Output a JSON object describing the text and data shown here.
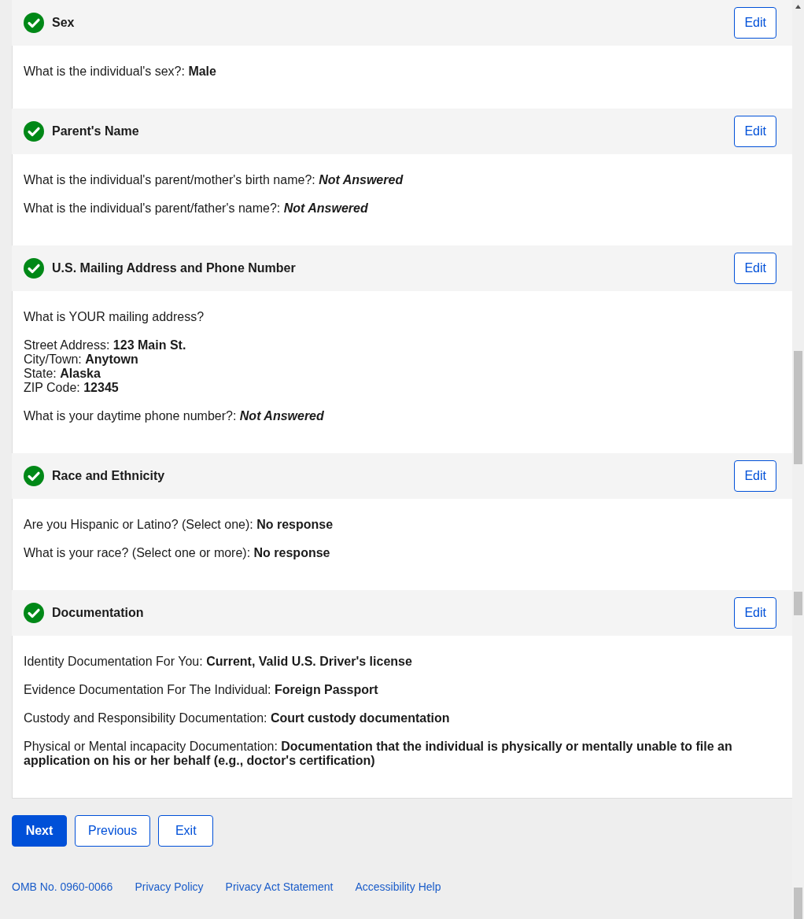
{
  "sections": [
    {
      "title": "Sex",
      "completed": true,
      "edit_button": "Edit",
      "items": [
        {
          "kind": "answer",
          "question": "What is the individual's sex?:",
          "answer": "Male",
          "answered": true
        }
      ]
    },
    {
      "title": "Parent's Name",
      "completed": true,
      "edit_button": "Edit",
      "items": [
        {
          "kind": "answer",
          "question": "What is the individual's parent/mother's birth name?:",
          "answer": "Not Answered",
          "answered": false
        },
        {
          "kind": "answer",
          "question": "What is the individual's parent/father's name?:",
          "answer": "Not Answered",
          "answered": false
        }
      ]
    },
    {
      "title": "U.S. Mailing Address and Phone Number",
      "completed": true,
      "edit_button": "Edit",
      "items": [
        {
          "kind": "heading",
          "text": "What is YOUR mailing address?"
        },
        {
          "kind": "address",
          "lines": [
            {
              "label": "Street Address:",
              "value": "123 Main St."
            },
            {
              "label": "City/Town:",
              "value": "Anytown"
            },
            {
              "label": "State:",
              "value": "Alaska"
            },
            {
              "label": "ZIP Code:",
              "value": "12345"
            }
          ]
        },
        {
          "kind": "answer",
          "question": "What is your daytime phone number?:",
          "answer": "Not Answered",
          "answered": false
        }
      ]
    },
    {
      "title": "Race and Ethnicity",
      "completed": true,
      "edit_button": "Edit",
      "items": [
        {
          "kind": "answer",
          "question": "Are you Hispanic or Latino? (Select one):",
          "answer": "No response",
          "answered": true
        },
        {
          "kind": "answer",
          "question": "What is your race? (Select one or more):",
          "answer": "No response",
          "answered": true
        }
      ]
    },
    {
      "title": "Documentation",
      "completed": true,
      "edit_button": "Edit",
      "items": [
        {
          "kind": "answer",
          "question": "Identity Documentation For You:",
          "answer": "Current, Valid U.S. Driver's license",
          "answered": true
        },
        {
          "kind": "answer",
          "question": "Evidence Documentation For The Individual:",
          "answer": "Foreign Passport",
          "answered": true
        },
        {
          "kind": "answer",
          "question": "Custody and Responsibility Documentation:",
          "answer": "Court custody documentation",
          "answered": true
        },
        {
          "kind": "answer",
          "question": "Physical or Mental incapacity Documentation:",
          "answer": "Documentation that the individual is physically or mentally unable to file an application on his or her behalf (e.g., doctor's certification)",
          "answered": true
        }
      ]
    }
  ],
  "buttons": [
    {
      "label": "Next",
      "kind": "primary"
    },
    {
      "label": "Previous",
      "kind": "secondary"
    },
    {
      "label": "Exit",
      "kind": "secondary"
    }
  ],
  "footer_links": [
    "OMB No. 0960-0066",
    "Privacy Policy",
    "Privacy Act Statement",
    "Accessibility Help"
  ]
}
